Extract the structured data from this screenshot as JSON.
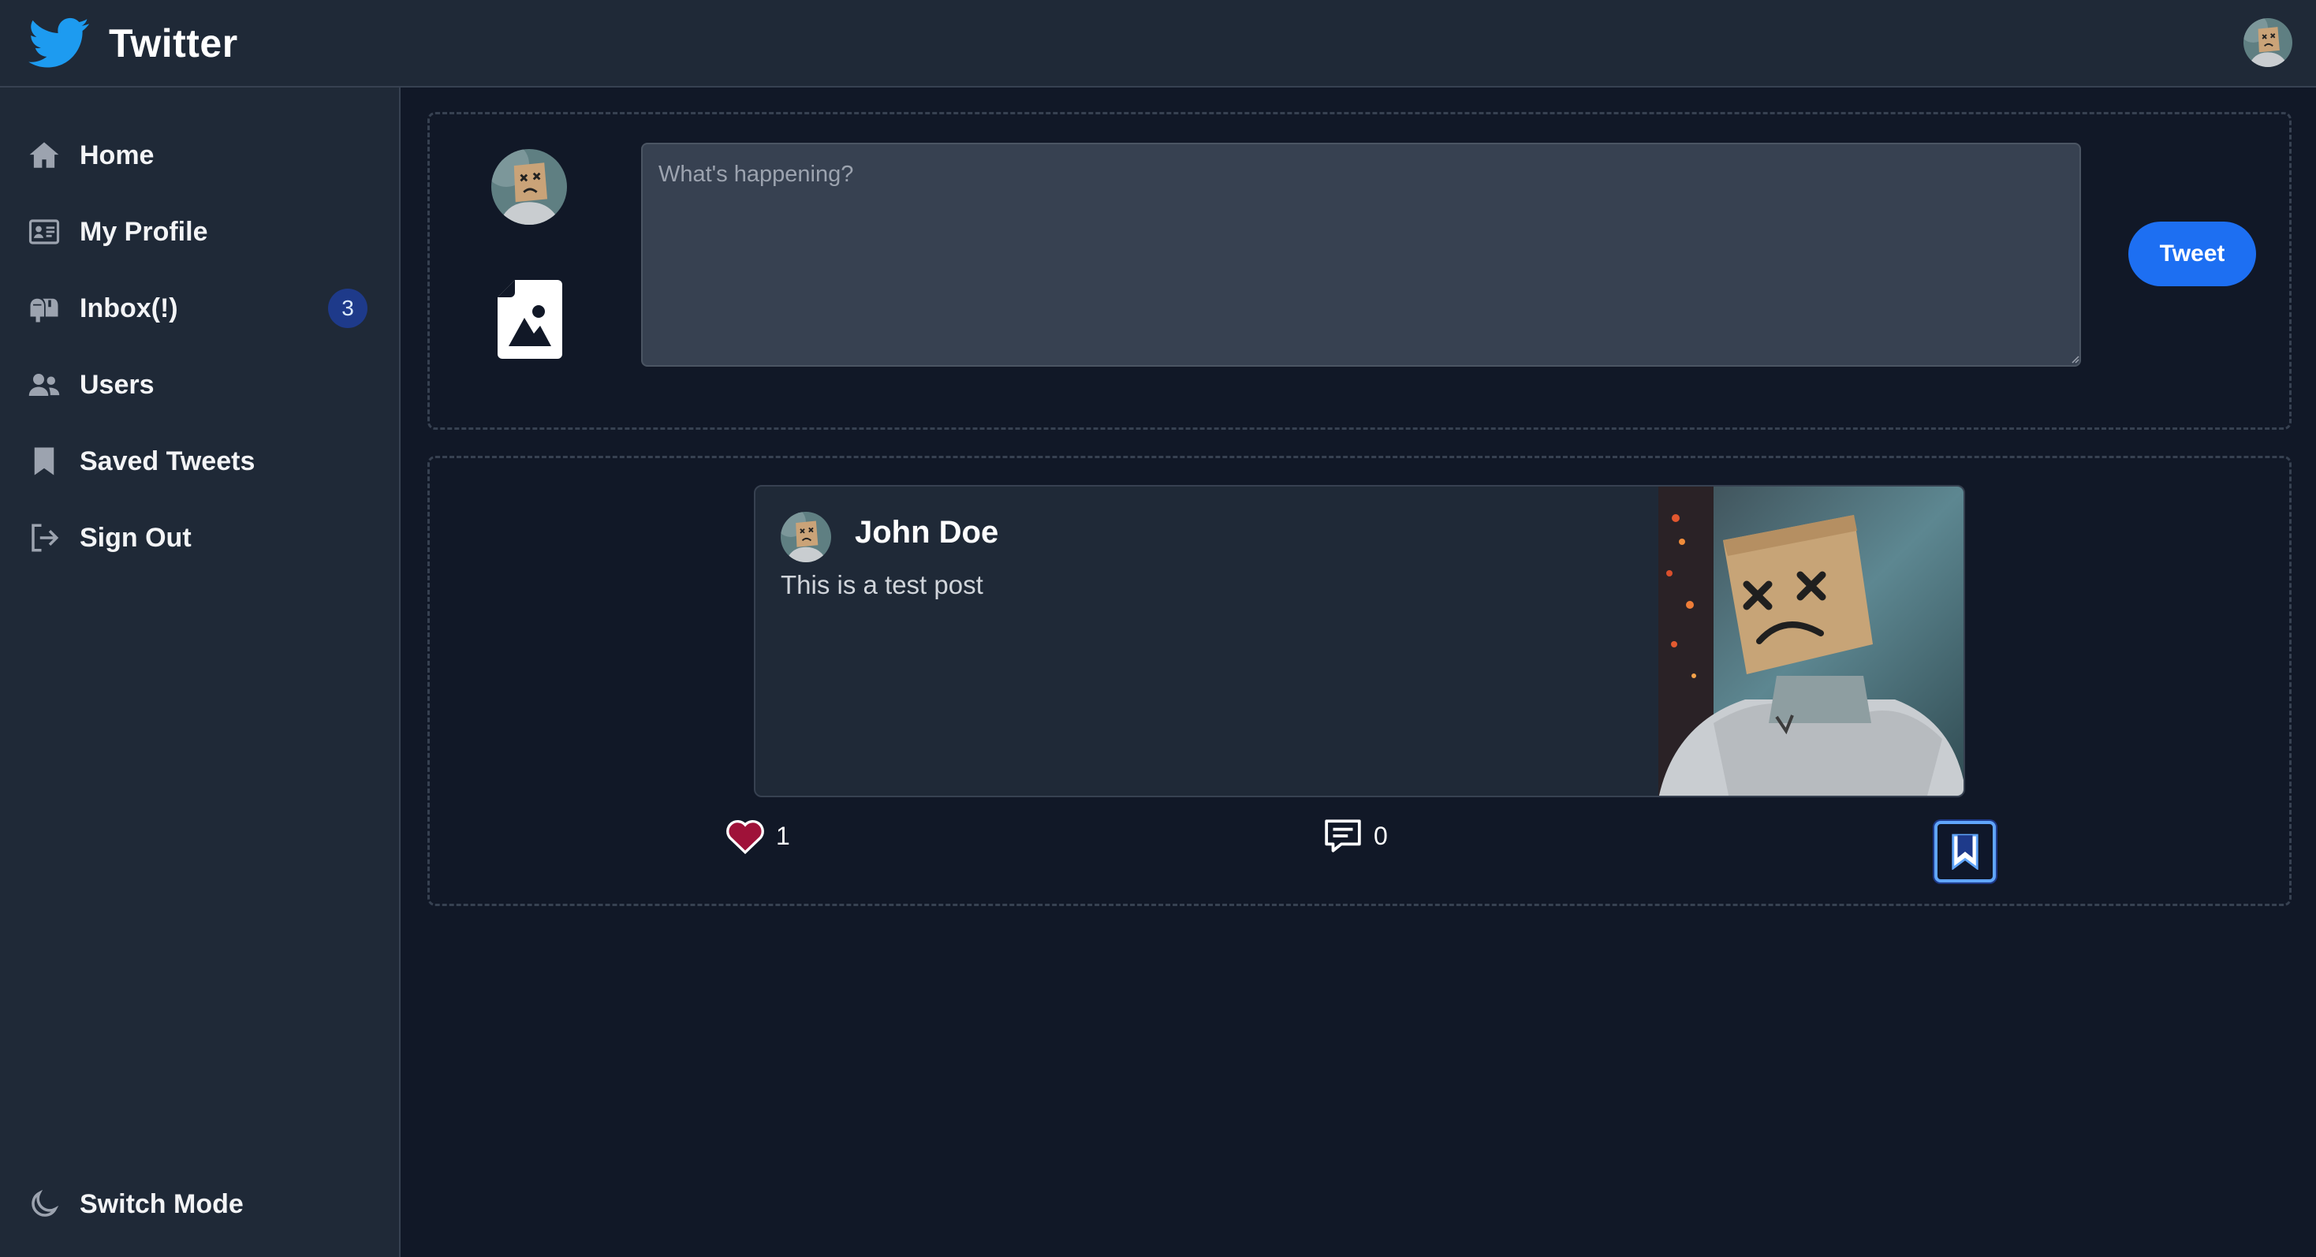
{
  "app": {
    "title": "Twitter",
    "brand_color": "#1d9bf0"
  },
  "sidebar": {
    "items": [
      {
        "label": "Home",
        "icon": "home-icon"
      },
      {
        "label": "My Profile",
        "icon": "id-card-icon"
      },
      {
        "label": "Inbox(!)",
        "icon": "mailbox-icon",
        "badge": "3"
      },
      {
        "label": "Users",
        "icon": "users-icon"
      },
      {
        "label": "Saved Tweets",
        "icon": "bookmark-icon"
      },
      {
        "label": "Sign Out",
        "icon": "sign-out-icon"
      }
    ],
    "switch_mode": {
      "label": "Switch Mode",
      "icon": "moon-icon"
    }
  },
  "composer": {
    "placeholder": "What's happening?",
    "value": "",
    "tweet_button": "Tweet",
    "button_color": "#1d6ff2"
  },
  "feed": {
    "tweets": [
      {
        "author": "John Doe",
        "text": "This is a test post",
        "likes": "1",
        "comments": "0",
        "liked": true,
        "bookmarked": true
      }
    ]
  },
  "colors": {
    "background": "#111827",
    "panel": "#1f2937",
    "like": "#e11d48",
    "focus": "#60a5fa"
  }
}
